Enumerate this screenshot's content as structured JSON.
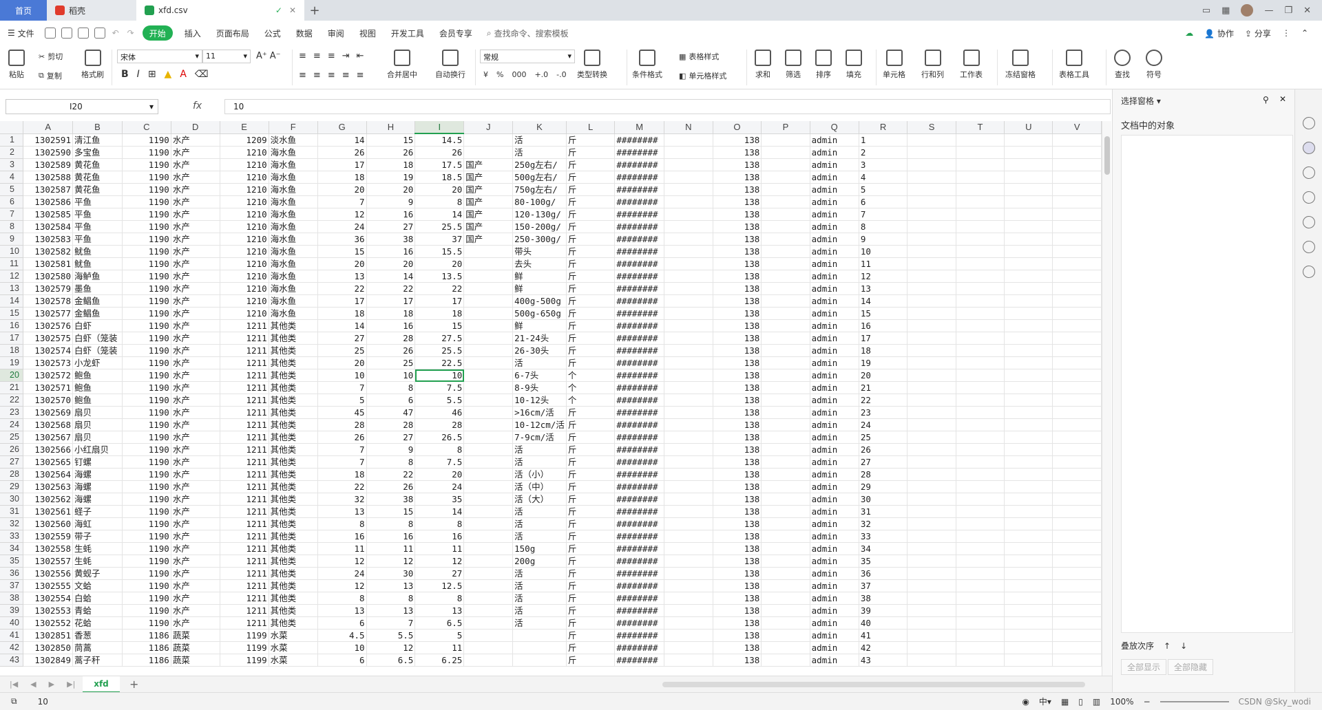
{
  "tabs": {
    "home": "首页",
    "daoke": "稻壳",
    "file": "xfd.csv"
  },
  "menu": {
    "file": "文件",
    "items": [
      "开始",
      "插入",
      "页面布局",
      "公式",
      "数据",
      "审阅",
      "视图",
      "开发工具",
      "会员专享"
    ],
    "search": "查找命令、搜索模板",
    "collab": "协作",
    "share": "分享"
  },
  "ribbon": {
    "paste": "粘贴",
    "cut": "剪切",
    "copy": "复制",
    "painter": "格式刷",
    "font": "宋体",
    "size": "11",
    "number_format": "常规",
    "merge": "合并居中",
    "wrap": "自动换行",
    "convert": "类型转换",
    "cond": "条件格式",
    "table_style": "表格样式",
    "cell_style": "单元格样式",
    "sum": "求和",
    "filter": "筛选",
    "sort": "排序",
    "fill": "填充",
    "cell": "单元格",
    "rowcol": "行和列",
    "sheet": "工作表",
    "freeze": "冻结窗格",
    "tabletool": "表格工具",
    "find": "查找",
    "symbol": "符号"
  },
  "formula": {
    "cell_ref": "I20",
    "fx": "fx",
    "value": "10"
  },
  "columns": [
    "A",
    "B",
    "C",
    "D",
    "E",
    "F",
    "G",
    "H",
    "I",
    "J",
    "K",
    "L",
    "M",
    "N",
    "O",
    "P",
    "Q",
    "R",
    "S",
    "T",
    "U",
    "V"
  ],
  "selected_col": "I",
  "selected_row": 20,
  "rows": [
    {
      "r": "1",
      "a": "1302591",
      "b": "清江鱼",
      "c": "1190",
      "d": "水产",
      "e": "1209",
      "f": "淡水鱼",
      "g": "14",
      "h": "15",
      "i": "14.5",
      "j": "",
      "k": "活",
      "l": "斤",
      "m": "########",
      "o": "138",
      "q": "admin"
    },
    {
      "r": "2",
      "a": "1302590",
      "b": "多宝鱼",
      "c": "1190",
      "d": "水产",
      "e": "1210",
      "f": "海水鱼",
      "g": "26",
      "h": "26",
      "i": "26",
      "j": "",
      "k": "活",
      "l": "斤",
      "m": "########",
      "o": "138",
      "q": "admin"
    },
    {
      "r": "3",
      "a": "1302589",
      "b": "黄花鱼",
      "c": "1190",
      "d": "水产",
      "e": "1210",
      "f": "海水鱼",
      "g": "17",
      "h": "18",
      "i": "17.5",
      "j": "国产",
      "k": "250g左右/",
      "l": "斤",
      "m": "########",
      "o": "138",
      "q": "admin"
    },
    {
      "r": "4",
      "a": "1302588",
      "b": "黄花鱼",
      "c": "1190",
      "d": "水产",
      "e": "1210",
      "f": "海水鱼",
      "g": "18",
      "h": "19",
      "i": "18.5",
      "j": "国产",
      "k": "500g左右/",
      "l": "斤",
      "m": "########",
      "o": "138",
      "q": "admin"
    },
    {
      "r": "5",
      "a": "1302587",
      "b": "黄花鱼",
      "c": "1190",
      "d": "水产",
      "e": "1210",
      "f": "海水鱼",
      "g": "20",
      "h": "20",
      "i": "20",
      "j": "国产",
      "k": "750g左右/",
      "l": "斤",
      "m": "########",
      "o": "138",
      "q": "admin"
    },
    {
      "r": "6",
      "a": "1302586",
      "b": "平鱼",
      "c": "1190",
      "d": "水产",
      "e": "1210",
      "f": "海水鱼",
      "g": "7",
      "h": "9",
      "i": "8",
      "j": "国产",
      "k": "80-100g/",
      "l": "斤",
      "m": "########",
      "o": "138",
      "q": "admin"
    },
    {
      "r": "7",
      "a": "1302585",
      "b": "平鱼",
      "c": "1190",
      "d": "水产",
      "e": "1210",
      "f": "海水鱼",
      "g": "12",
      "h": "16",
      "i": "14",
      "j": "国产",
      "k": "120-130g/",
      "l": "斤",
      "m": "########",
      "o": "138",
      "q": "admin"
    },
    {
      "r": "8",
      "a": "1302584",
      "b": "平鱼",
      "c": "1190",
      "d": "水产",
      "e": "1210",
      "f": "海水鱼",
      "g": "24",
      "h": "27",
      "i": "25.5",
      "j": "国产",
      "k": "150-200g/",
      "l": "斤",
      "m": "########",
      "o": "138",
      "q": "admin"
    },
    {
      "r": "9",
      "a": "1302583",
      "b": "平鱼",
      "c": "1190",
      "d": "水产",
      "e": "1210",
      "f": "海水鱼",
      "g": "36",
      "h": "38",
      "i": "37",
      "j": "国产",
      "k": "250-300g/",
      "l": "斤",
      "m": "########",
      "o": "138",
      "q": "admin"
    },
    {
      "r": "10",
      "a": "1302582",
      "b": "鱿鱼",
      "c": "1190",
      "d": "水产",
      "e": "1210",
      "f": "海水鱼",
      "g": "15",
      "h": "16",
      "i": "15.5",
      "j": "",
      "k": "带头",
      "l": "斤",
      "m": "########",
      "o": "138",
      "q": "admin"
    },
    {
      "r": "11",
      "a": "1302581",
      "b": "鱿鱼",
      "c": "1190",
      "d": "水产",
      "e": "1210",
      "f": "海水鱼",
      "g": "20",
      "h": "20",
      "i": "20",
      "j": "",
      "k": "去头",
      "l": "斤",
      "m": "########",
      "o": "138",
      "q": "admin"
    },
    {
      "r": "12",
      "a": "1302580",
      "b": "海鲈鱼",
      "c": "1190",
      "d": "水产",
      "e": "1210",
      "f": "海水鱼",
      "g": "13",
      "h": "14",
      "i": "13.5",
      "j": "",
      "k": "鲜",
      "l": "斤",
      "m": "########",
      "o": "138",
      "q": "admin"
    },
    {
      "r": "13",
      "a": "1302579",
      "b": "墨鱼",
      "c": "1190",
      "d": "水产",
      "e": "1210",
      "f": "海水鱼",
      "g": "22",
      "h": "22",
      "i": "22",
      "j": "",
      "k": "鲜",
      "l": "斤",
      "m": "########",
      "o": "138",
      "q": "admin"
    },
    {
      "r": "14",
      "a": "1302578",
      "b": "金鲳鱼",
      "c": "1190",
      "d": "水产",
      "e": "1210",
      "f": "海水鱼",
      "g": "17",
      "h": "17",
      "i": "17",
      "j": "",
      "k": "400g-500g",
      "l": "斤",
      "m": "########",
      "o": "138",
      "q": "admin"
    },
    {
      "r": "15",
      "a": "1302577",
      "b": "金鲳鱼",
      "c": "1190",
      "d": "水产",
      "e": "1210",
      "f": "海水鱼",
      "g": "18",
      "h": "18",
      "i": "18",
      "j": "",
      "k": "500g-650g",
      "l": "斤",
      "m": "########",
      "o": "138",
      "q": "admin"
    },
    {
      "r": "16",
      "a": "1302576",
      "b": "白虾",
      "c": "1190",
      "d": "水产",
      "e": "1211",
      "f": "其他类",
      "g": "14",
      "h": "16",
      "i": "15",
      "j": "",
      "k": "鲜",
      "l": "斤",
      "m": "########",
      "o": "138",
      "q": "admin"
    },
    {
      "r": "17",
      "a": "1302575",
      "b": "白虾（笼装",
      "c": "1190",
      "d": "水产",
      "e": "1211",
      "f": "其他类",
      "g": "27",
      "h": "28",
      "i": "27.5",
      "j": "",
      "k": "21-24头",
      "l": "斤",
      "m": "########",
      "o": "138",
      "q": "admin"
    },
    {
      "r": "18",
      "a": "1302574",
      "b": "白虾（笼装",
      "c": "1190",
      "d": "水产",
      "e": "1211",
      "f": "其他类",
      "g": "25",
      "h": "26",
      "i": "25.5",
      "j": "",
      "k": "26-30头",
      "l": "斤",
      "m": "########",
      "o": "138",
      "q": "admin"
    },
    {
      "r": "19",
      "a": "1302573",
      "b": "小龙虾",
      "c": "1190",
      "d": "水产",
      "e": "1211",
      "f": "其他类",
      "g": "20",
      "h": "25",
      "i": "22.5",
      "j": "",
      "k": "活",
      "l": "斤",
      "m": "########",
      "o": "138",
      "q": "admin"
    },
    {
      "r": "20",
      "a": "1302572",
      "b": "鲍鱼",
      "c": "1190",
      "d": "水产",
      "e": "1211",
      "f": "其他类",
      "g": "10",
      "h": "10",
      "i": "10",
      "j": "",
      "k": "6-7头",
      "l": "个",
      "m": "########",
      "o": "138",
      "q": "admin"
    },
    {
      "r": "21",
      "a": "1302571",
      "b": "鲍鱼",
      "c": "1190",
      "d": "水产",
      "e": "1211",
      "f": "其他类",
      "g": "7",
      "h": "8",
      "i": "7.5",
      "j": "",
      "k": "8-9头",
      "l": "个",
      "m": "########",
      "o": "138",
      "q": "admin"
    },
    {
      "r": "22",
      "a": "1302570",
      "b": "鲍鱼",
      "c": "1190",
      "d": "水产",
      "e": "1211",
      "f": "其他类",
      "g": "5",
      "h": "6",
      "i": "5.5",
      "j": "",
      "k": "10-12头",
      "l": "个",
      "m": "########",
      "o": "138",
      "q": "admin"
    },
    {
      "r": "23",
      "a": "1302569",
      "b": "扇贝",
      "c": "1190",
      "d": "水产",
      "e": "1211",
      "f": "其他类",
      "g": "45",
      "h": "47",
      "i": "46",
      "j": "",
      "k": ">16cm/活",
      "l": "斤",
      "m": "########",
      "o": "138",
      "q": "admin"
    },
    {
      "r": "24",
      "a": "1302568",
      "b": "扇贝",
      "c": "1190",
      "d": "水产",
      "e": "1211",
      "f": "其他类",
      "g": "28",
      "h": "28",
      "i": "28",
      "j": "",
      "k": "10-12cm/活",
      "l": "斤",
      "m": "########",
      "o": "138",
      "q": "admin"
    },
    {
      "r": "25",
      "a": "1302567",
      "b": "扇贝",
      "c": "1190",
      "d": "水产",
      "e": "1211",
      "f": "其他类",
      "g": "26",
      "h": "27",
      "i": "26.5",
      "j": "",
      "k": "7-9cm/活",
      "l": "斤",
      "m": "########",
      "o": "138",
      "q": "admin"
    },
    {
      "r": "26",
      "a": "1302566",
      "b": "小红扇贝",
      "c": "1190",
      "d": "水产",
      "e": "1211",
      "f": "其他类",
      "g": "7",
      "h": "9",
      "i": "8",
      "j": "",
      "k": "活",
      "l": "斤",
      "m": "########",
      "o": "138",
      "q": "admin"
    },
    {
      "r": "27",
      "a": "1302565",
      "b": "钉螺",
      "c": "1190",
      "d": "水产",
      "e": "1211",
      "f": "其他类",
      "g": "7",
      "h": "8",
      "i": "7.5",
      "j": "",
      "k": "活",
      "l": "斤",
      "m": "########",
      "o": "138",
      "q": "admin"
    },
    {
      "r": "28",
      "a": "1302564",
      "b": "海螺",
      "c": "1190",
      "d": "水产",
      "e": "1211",
      "f": "其他类",
      "g": "18",
      "h": "22",
      "i": "20",
      "j": "",
      "k": "活（小）",
      "l": "斤",
      "m": "########",
      "o": "138",
      "q": "admin"
    },
    {
      "r": "29",
      "a": "1302563",
      "b": "海螺",
      "c": "1190",
      "d": "水产",
      "e": "1211",
      "f": "其他类",
      "g": "22",
      "h": "26",
      "i": "24",
      "j": "",
      "k": "活（中）",
      "l": "斤",
      "m": "########",
      "o": "138",
      "q": "admin"
    },
    {
      "r": "30",
      "a": "1302562",
      "b": "海螺",
      "c": "1190",
      "d": "水产",
      "e": "1211",
      "f": "其他类",
      "g": "32",
      "h": "38",
      "i": "35",
      "j": "",
      "k": "活（大）",
      "l": "斤",
      "m": "########",
      "o": "138",
      "q": "admin"
    },
    {
      "r": "31",
      "a": "1302561",
      "b": "蛏子",
      "c": "1190",
      "d": "水产",
      "e": "1211",
      "f": "其他类",
      "g": "13",
      "h": "15",
      "i": "14",
      "j": "",
      "k": "活",
      "l": "斤",
      "m": "########",
      "o": "138",
      "q": "admin"
    },
    {
      "r": "32",
      "a": "1302560",
      "b": "海虹",
      "c": "1190",
      "d": "水产",
      "e": "1211",
      "f": "其他类",
      "g": "8",
      "h": "8",
      "i": "8",
      "j": "",
      "k": "活",
      "l": "斤",
      "m": "########",
      "o": "138",
      "q": "admin"
    },
    {
      "r": "33",
      "a": "1302559",
      "b": "带子",
      "c": "1190",
      "d": "水产",
      "e": "1211",
      "f": "其他类",
      "g": "16",
      "h": "16",
      "i": "16",
      "j": "",
      "k": "活",
      "l": "斤",
      "m": "########",
      "o": "138",
      "q": "admin"
    },
    {
      "r": "34",
      "a": "1302558",
      "b": "生蚝",
      "c": "1190",
      "d": "水产",
      "e": "1211",
      "f": "其他类",
      "g": "11",
      "h": "11",
      "i": "11",
      "j": "",
      "k": "150g",
      "l": "斤",
      "m": "########",
      "o": "138",
      "q": "admin"
    },
    {
      "r": "35",
      "a": "1302557",
      "b": "生蚝",
      "c": "1190",
      "d": "水产",
      "e": "1211",
      "f": "其他类",
      "g": "12",
      "h": "12",
      "i": "12",
      "j": "",
      "k": "200g",
      "l": "斤",
      "m": "########",
      "o": "138",
      "q": "admin"
    },
    {
      "r": "36",
      "a": "1302556",
      "b": "黄蚬子",
      "c": "1190",
      "d": "水产",
      "e": "1211",
      "f": "其他类",
      "g": "24",
      "h": "30",
      "i": "27",
      "j": "",
      "k": "活",
      "l": "斤",
      "m": "########",
      "o": "138",
      "q": "admin"
    },
    {
      "r": "37",
      "a": "1302555",
      "b": "文蛤",
      "c": "1190",
      "d": "水产",
      "e": "1211",
      "f": "其他类",
      "g": "12",
      "h": "13",
      "i": "12.5",
      "j": "",
      "k": "活",
      "l": "斤",
      "m": "########",
      "o": "138",
      "q": "admin"
    },
    {
      "r": "38",
      "a": "1302554",
      "b": "白蛤",
      "c": "1190",
      "d": "水产",
      "e": "1211",
      "f": "其他类",
      "g": "8",
      "h": "8",
      "i": "8",
      "j": "",
      "k": "活",
      "l": "斤",
      "m": "########",
      "o": "138",
      "q": "admin"
    },
    {
      "r": "39",
      "a": "1302553",
      "b": "青蛤",
      "c": "1190",
      "d": "水产",
      "e": "1211",
      "f": "其他类",
      "g": "13",
      "h": "13",
      "i": "13",
      "j": "",
      "k": "活",
      "l": "斤",
      "m": "########",
      "o": "138",
      "q": "admin"
    },
    {
      "r": "40",
      "a": "1302552",
      "b": "花蛤",
      "c": "1190",
      "d": "水产",
      "e": "1211",
      "f": "其他类",
      "g": "6",
      "h": "7",
      "i": "6.5",
      "j": "",
      "k": "活",
      "l": "斤",
      "m": "########",
      "o": "138",
      "q": "admin"
    },
    {
      "r": "41",
      "a": "1302851",
      "b": "香葱",
      "c": "1186",
      "d": "蔬菜",
      "e": "1199",
      "f": "水菜",
      "g": "4.5",
      "h": "5.5",
      "i": "5",
      "j": "",
      "k": "",
      "l": "斤",
      "m": "########",
      "o": "138",
      "q": "admin"
    },
    {
      "r": "42",
      "a": "1302850",
      "b": "茼蒿",
      "c": "1186",
      "d": "蔬菜",
      "e": "1199",
      "f": "水菜",
      "g": "10",
      "h": "12",
      "i": "11",
      "j": "",
      "k": "",
      "l": "斤",
      "m": "########",
      "o": "138",
      "q": "admin"
    },
    {
      "r": "43",
      "a": "1302849",
      "b": "蒿子秆",
      "c": "1186",
      "d": "蔬菜",
      "e": "1199",
      "f": "水菜",
      "g": "6",
      "h": "6.5",
      "i": "6.25",
      "j": "",
      "k": "",
      "l": "斤",
      "m": "########",
      "o": "138",
      "q": "admin"
    }
  ],
  "sheet": {
    "name": "xfd"
  },
  "status": {
    "value": "10",
    "zoom": "100%",
    "watermark": "CSDN @Sky_wodi"
  },
  "panel": {
    "title": "选择窗格",
    "objects": "文档中的对象",
    "order": "叠放次序",
    "show_all": "全部显示",
    "hide_all": "全部隐藏"
  }
}
